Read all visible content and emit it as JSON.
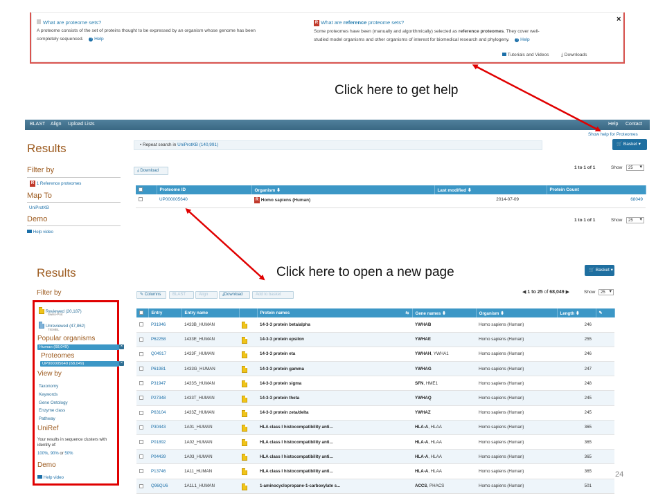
{
  "help_banner": {
    "left_heading": "What are proteome sets?",
    "left_text_1": "A proteome consists of the set of proteins thought to be expressed by an organism whose genome has been",
    "left_text_2": "completely sequenced.",
    "left_help": "Help",
    "right_heading_a": "What are ",
    "right_heading_b": "reference",
    "right_heading_c": " proteome sets?",
    "right_text_1a": "Some proteomes have been (manually and algorithmically) selected as ",
    "right_text_1b": "reference proteomes",
    "right_text_1c": ". They cover well-",
    "right_text_2": "studied model organisms and other organisms of interest for biomedical research and phylogeny.",
    "right_help": "Help",
    "tutorials": "Tutorials and Videos",
    "downloads": "Downloads",
    "close": "×"
  },
  "callouts": {
    "help": "Click here to get help",
    "newpage": "Click here to open a new page"
  },
  "nav": {
    "items": [
      "BLAST",
      "Align",
      "Upload Lists"
    ],
    "help": "Help",
    "contact": "Contact",
    "show_help": "Show help for Proteomes"
  },
  "proteomes": {
    "title": "Results",
    "filter_by": "Filter by",
    "filter_item": "1 Reference proteomes",
    "map_to": "Map To",
    "map_item": "UniProtKB",
    "demo": "Demo",
    "help_video": "Help video",
    "repeat_search_a": "Repeat search in ",
    "repeat_search_b": "UniProtKB (140,991)",
    "basket": "Basket",
    "download": "Download",
    "pager": "1 to 1 of 1",
    "show": "Show",
    "show_value": "25",
    "columns": [
      "Proteome ID",
      "Organism",
      "Last modified",
      "Protein Count"
    ],
    "rows": [
      {
        "id": "UP000005640",
        "organism": "Homo sapiens (Human)",
        "modified": "2014-07-09",
        "count": "68049"
      }
    ]
  },
  "uniprot": {
    "title": "Results",
    "filter_by": "Filter by",
    "reviewed": "Reviewed (20,187)",
    "reviewed_sub": "Swiss-Prot",
    "unreviewed": "Unreviewed (47,862)",
    "unreviewed_sub": "TrEMBL",
    "popular_organisms": "Popular organisms",
    "human_pill": "Human (68,049)",
    "proteomes": "Proteomes",
    "proteome_pill": "UP000005640 (68,049)",
    "view_by": "View by",
    "view_items": [
      "Taxonomy",
      "Keywords",
      "Gene Ontology",
      "Enzyme class",
      "Pathway"
    ],
    "uniref": "UniRef",
    "uniref_text_1": "Your results in sequence clusters with",
    "uniref_text_2": "identity of:",
    "uniref_links": [
      "100%",
      "90%",
      "50%"
    ],
    "uniref_sep_1": ", ",
    "uniref_sep_2": " or ",
    "demo": "Demo",
    "help_video": "Help video",
    "basket": "Basket",
    "toolbar": [
      "Columns",
      "BLAST",
      "Align",
      "Download",
      "Add to basket"
    ],
    "pager_a": "1 to 25",
    "pager_b": " of ",
    "pager_c": "68,049",
    "show": "Show",
    "show_value": "25",
    "columns": [
      "Entry",
      "Entry name",
      "Protein names",
      "Gene names",
      "Organism",
      "Length"
    ],
    "rows": [
      {
        "entry": "P31946",
        "name": "1433B_HUMAN",
        "protein": "14-3-3 protein beta/alpha",
        "gene": "YWHAB",
        "gene_extra": "",
        "organism": "Homo sapiens (Human)",
        "length": "246"
      },
      {
        "entry": "P62258",
        "name": "1433E_HUMAN",
        "protein": "14-3-3 protein epsilon",
        "gene": "YWHAE",
        "gene_extra": "",
        "organism": "Homo sapiens (Human)",
        "length": "255"
      },
      {
        "entry": "Q04917",
        "name": "1433F_HUMAN",
        "protein": "14-3-3 protein eta",
        "gene": "YWHAH",
        "gene_extra": ", YWHA1",
        "organism": "Homo sapiens (Human)",
        "length": "246"
      },
      {
        "entry": "P61981",
        "name": "1433G_HUMAN",
        "protein": "14-3-3 protein gamma",
        "gene": "YWHAG",
        "gene_extra": "",
        "organism": "Homo sapiens (Human)",
        "length": "247"
      },
      {
        "entry": "P31947",
        "name": "1433S_HUMAN",
        "protein": "14-3-3 protein sigma",
        "gene": "SFN",
        "gene_extra": ", HME1",
        "organism": "Homo sapiens (Human)",
        "length": "248"
      },
      {
        "entry": "P27348",
        "name": "1433T_HUMAN",
        "protein": "14-3-3 protein theta",
        "gene": "YWHAQ",
        "gene_extra": "",
        "organism": "Homo sapiens (Human)",
        "length": "245"
      },
      {
        "entry": "P63104",
        "name": "1433Z_HUMAN",
        "protein": "14-3-3 protein zeta/delta",
        "gene": "YWHAZ",
        "gene_extra": "",
        "organism": "Homo sapiens (Human)",
        "length": "245"
      },
      {
        "entry": "P30443",
        "name": "1A01_HUMAN",
        "protein": "HLA class I histocompatibility anti...",
        "gene": "HLA-A",
        "gene_extra": ", HLAA",
        "organism": "Homo sapiens (Human)",
        "length": "365"
      },
      {
        "entry": "P01892",
        "name": "1A02_HUMAN",
        "protein": "HLA class I histocompatibility anti...",
        "gene": "HLA-A",
        "gene_extra": ", HLAA",
        "organism": "Homo sapiens (Human)",
        "length": "365"
      },
      {
        "entry": "P04439",
        "name": "1A03_HUMAN",
        "protein": "HLA class I histocompatibility anti...",
        "gene": "HLA-A",
        "gene_extra": ", HLAA",
        "organism": "Homo sapiens (Human)",
        "length": "365"
      },
      {
        "entry": "P13746",
        "name": "1A11_HUMAN",
        "protein": "HLA class I histocompatibility anti...",
        "gene": "HLA-A",
        "gene_extra": ", HLAA",
        "organism": "Homo sapiens (Human)",
        "length": "365"
      },
      {
        "entry": "Q96QU6",
        "name": "1A1L1_HUMAN",
        "protein": "1-aminocyclopropane-1-carboxylate s...",
        "gene": "ACCS",
        "gene_extra": ", PHACS",
        "organism": "Homo sapiens (Human)",
        "length": "501"
      }
    ]
  },
  "page_number": "24",
  "colors": {
    "accent": "#3c97c6",
    "heading": "#9c5a1e",
    "arrow": "#e00000",
    "nav": "#3a6883"
  },
  "icons": [
    "close-icon",
    "help-icon",
    "video-icon",
    "download-icon",
    "basket-icon",
    "sort-icon",
    "reference-icon",
    "reviewed-doc-icon",
    "unreviewed-doc-icon",
    "pencil-icon",
    "arrow-left-icon",
    "arrow-right-icon"
  ]
}
